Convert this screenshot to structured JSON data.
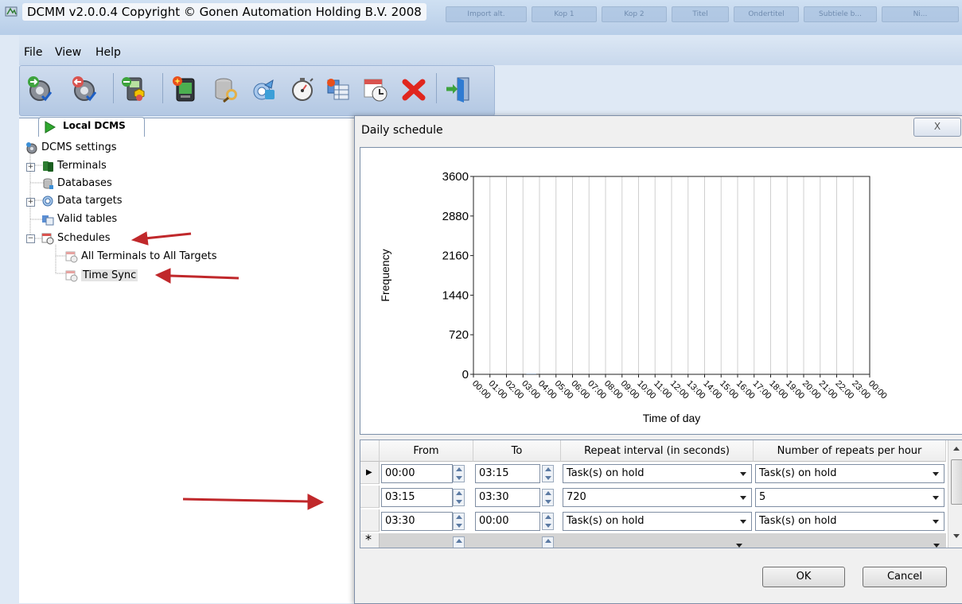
{
  "window": {
    "title": "DCMM v2.0.0.4 Copyright © Gonen Automation Holding B.V. 2008",
    "bg_tabs": [
      "Import alt.",
      "Kop 1",
      "Kop 2",
      "Titel",
      "Ondertitel",
      "Subtiele b...",
      "Ni..."
    ]
  },
  "menu": {
    "items": [
      "File",
      "View",
      "Help"
    ]
  },
  "toolbar": {
    "buttons": [
      "start-service-icon",
      "stop-service-icon",
      "terminal-status-icon",
      "terminal-icon",
      "database-icon",
      "stopwatch-icon",
      "data-target-icon",
      "schedule-icon",
      "delete-icon",
      "exit-icon"
    ]
  },
  "left_panel": {
    "tab_label": "Local DCMS",
    "tree": {
      "root": "DCMS settings",
      "terminals": "Terminals",
      "databases": "Databases",
      "data_targets": "Data targets",
      "valid_tables": "Valid tables",
      "schedules": "Schedules",
      "schedule_items": [
        "All Terminals to All Targets",
        "Time Sync"
      ]
    }
  },
  "dialog": {
    "title": "Daily schedule",
    "close_glyph": "X",
    "ok_label": "OK",
    "cancel_label": "Cancel"
  },
  "chart_data": {
    "type": "bar",
    "xlabel": "Time of day",
    "ylabel": "Frequency",
    "ylim": [
      0,
      3600
    ],
    "yticks": [
      0,
      720,
      1440,
      2160,
      2880,
      3600
    ],
    "categories": [
      "00:00",
      "01:00",
      "02:00",
      "03:00",
      "04:00",
      "05:00",
      "06:00",
      "07:00",
      "08:00",
      "09:00",
      "10:00",
      "11:00",
      "12:00",
      "13:00",
      "14:00",
      "15:00",
      "16:00",
      "17:00",
      "18:00",
      "19:00",
      "20:00",
      "21:00",
      "22:00",
      "23:00",
      "00:00"
    ],
    "values": [
      0,
      0,
      0,
      5,
      0,
      0,
      0,
      0,
      0,
      0,
      0,
      0,
      0,
      0,
      0,
      0,
      0,
      0,
      0,
      0,
      0,
      0,
      0,
      0,
      0
    ],
    "grid": true
  },
  "grid": {
    "columns": [
      "From",
      "To",
      "Repeat interval (in seconds)",
      "Number of repeats per hour"
    ],
    "rows": [
      {
        "from": "00:00",
        "to": "03:15",
        "interval": "Task(s) on hold",
        "repeats": "Task(s) on hold"
      },
      {
        "from": "03:15",
        "to": "03:30",
        "interval": "720",
        "repeats": "5"
      },
      {
        "from": "03:30",
        "to": "00:00",
        "interval": "Task(s) on hold",
        "repeats": "Task(s) on hold"
      }
    ],
    "current_row_glyph": "▶",
    "new_row_glyph": "*"
  },
  "annotations": {
    "arrow_color": "#c0282b"
  }
}
